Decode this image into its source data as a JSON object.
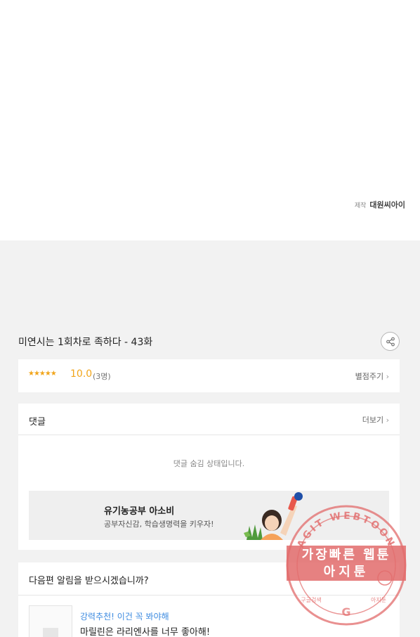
{
  "credit": {
    "label": "제작",
    "studio": "대원씨아이"
  },
  "episode": {
    "title": "미연시는 1회차로 족하다 - 43화"
  },
  "rating": {
    "stars": "★★★★★",
    "score": "10.0",
    "count": "(3명)",
    "action_label": "별점주기"
  },
  "comments": {
    "title": "댓글",
    "more_label": "더보기",
    "hidden_message": "댓글 숨김 상태입니다."
  },
  "ad": {
    "title": "유기농공부 아소비",
    "subtitle": "공부자신감, 학습생명력을 키우자!"
  },
  "notify": {
    "question": "다음편 알림을 받으시겠습니까?"
  },
  "recommend": {
    "heading": "강력추천! 이건 꼭 봐야해",
    "title": "마릴린은 라리엔사를 너무 좋아해!"
  },
  "watermark": {
    "ring_text": "AGIT WEBTOON",
    "line1": "가장빠른 웹툰",
    "line2": "아지툰",
    "bottom_left": "구글검색",
    "bottom_right": "아지툰"
  },
  "colors": {
    "accent_star": "#f1a51b",
    "link_blue": "#3d8be0",
    "stamp_red": "#e26b6b"
  }
}
